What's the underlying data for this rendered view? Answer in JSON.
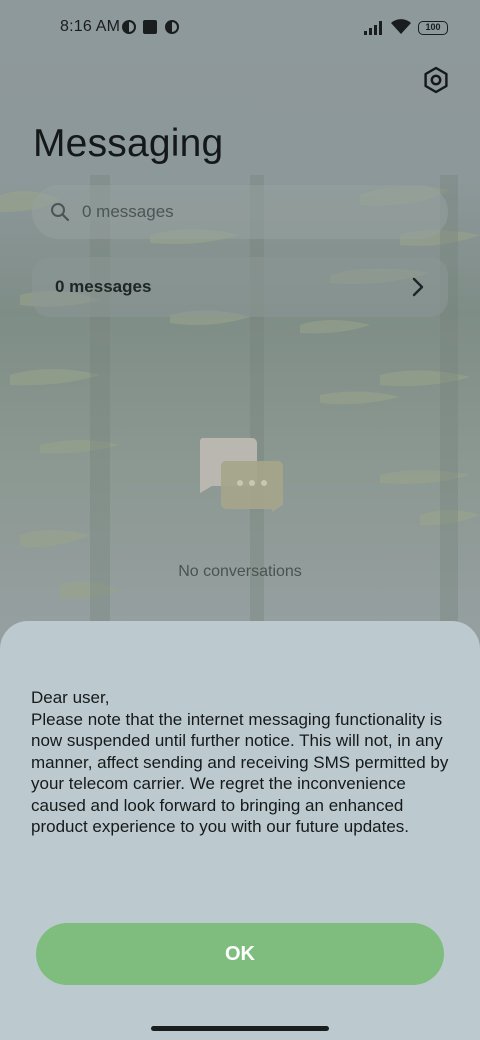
{
  "status_bar": {
    "time": "8:16 AM",
    "battery": "100",
    "icons": [
      "notification-app-icon",
      "notification-square-icon",
      "notification-app-icon",
      "signal-icon",
      "wifi-icon",
      "battery-icon"
    ]
  },
  "header": {
    "title": "Messaging",
    "settings_icon": "settings-hexagon-icon"
  },
  "search": {
    "placeholder": "0 messages",
    "icon": "search-icon"
  },
  "messages_row": {
    "label": "0 messages",
    "icon": "chevron-right-icon"
  },
  "empty_state": {
    "icon": "chat-bubbles-icon",
    "text": "No conversations"
  },
  "dialog": {
    "message": "Dear user,\nPlease note that the internet messaging functionality is now suspended until further notice. This will not, in any manner, affect sending and receiving SMS permitted by your telecom carrier. We regret the inconvenience caused and look forward to bringing an enhanced product experience to you with our future updates.",
    "ok_label": "OK"
  },
  "colors": {
    "accent_green": "#7ebd7e",
    "dialog_background": "#bccacf"
  }
}
